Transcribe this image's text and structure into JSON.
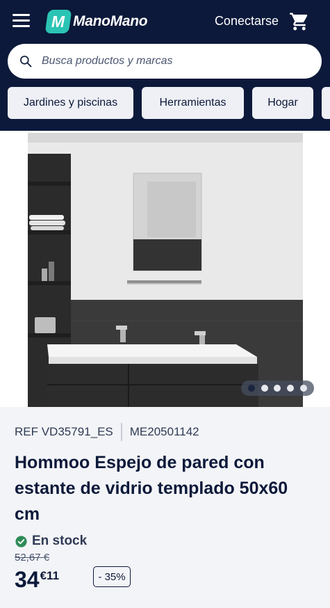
{
  "header": {
    "brand": "ManoMano",
    "brand_initial": "M",
    "login_label": "Conectarse",
    "icons": [
      "menu-icon",
      "cart-icon",
      "search-icon"
    ],
    "background_color": "#0c193a",
    "brand_color": "#2bc4b4"
  },
  "search": {
    "placeholder": "Busca productos y marcas",
    "value": ""
  },
  "categories": [
    {
      "label": "Jardines y piscinas"
    },
    {
      "label": "Herramientas"
    },
    {
      "label": "Hogar"
    },
    {
      "label": ""
    }
  ],
  "gallery": {
    "image_count": 5,
    "active_index": 0
  },
  "product": {
    "ref": "REF VD35791_ES",
    "code": "ME20501142",
    "title": "Hommoo Espejo de pared con estante de vidrio templado 50x60 cm",
    "stock_status": "En stock",
    "old_price": "52,67 €",
    "price_int": "34",
    "price_dec": "€11",
    "discount": "- 35%",
    "stock_color": "#2e8b57"
  }
}
